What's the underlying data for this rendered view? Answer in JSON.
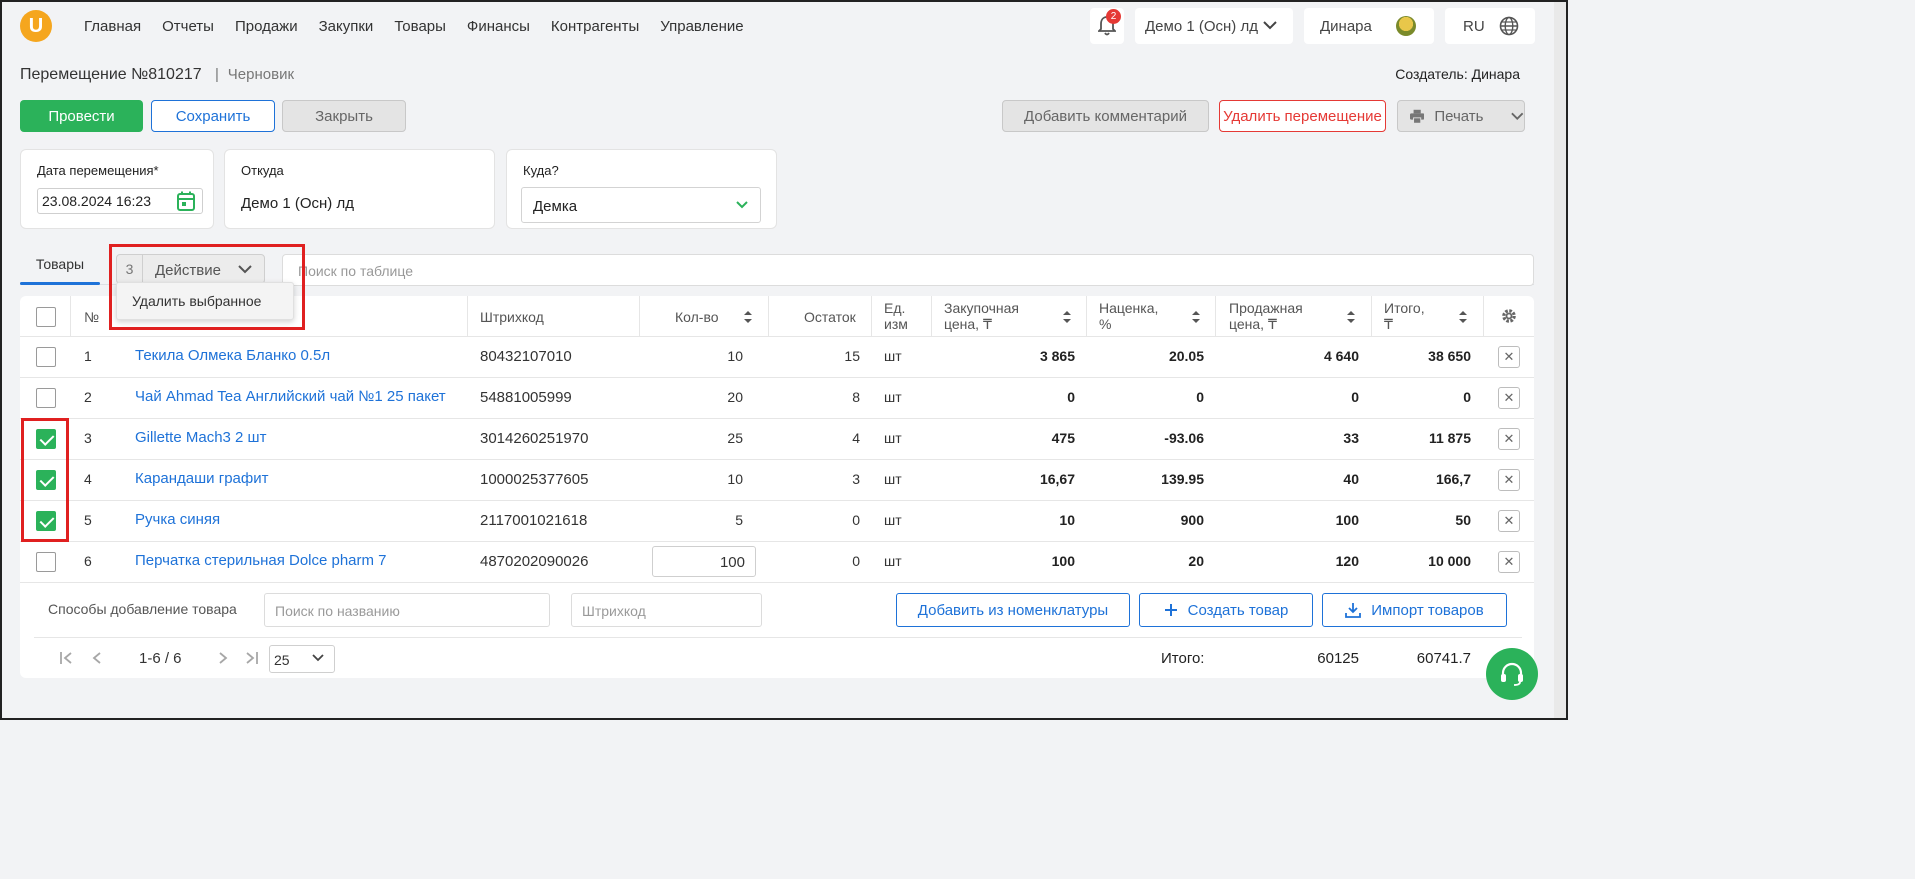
{
  "nav": {
    "logo": "U",
    "items": [
      "Главная",
      "Отчеты",
      "Продажи",
      "Закупки",
      "Товары",
      "Финансы",
      "Контрагенты",
      "Управление"
    ],
    "notifications": "2",
    "store": "Демо 1 (Осн) лд",
    "user": "Динара",
    "lang": "RU"
  },
  "header": {
    "title": "Перемещение №810217",
    "separator": "|",
    "status": "Черновик",
    "creator": "Создатель: Динара"
  },
  "toolbar": {
    "conduct": "Провести",
    "save": "Сохранить",
    "close": "Закрыть",
    "add_comment": "Добавить комментарий",
    "delete": "Удалить перемещение",
    "print": "Печать"
  },
  "fields": {
    "date_label": "Дата перемещения*",
    "date_value": "23.08.2024 16:23",
    "from_label": "Откуда",
    "from_value": "Демо 1 (Осн) лд",
    "to_label": "Куда?",
    "to_value": "Демка"
  },
  "tabs": {
    "goods": "Товары"
  },
  "actions": {
    "selected_count": "3",
    "label": "Действие",
    "dropdown_item": "Удалить выбранное",
    "search_placeholder": "Поиск по таблице"
  },
  "table": {
    "headers": {
      "num": "№",
      "barcode": "Штрихкод",
      "qty": "Кол-во",
      "stock": "Остаток",
      "unit_1": "Ед.",
      "unit_2": "изм",
      "purchase_1": "Закупочная",
      "purchase_2": "цена, ₸",
      "markup_1": "Наценка,",
      "markup_2": "%",
      "sale_1": "Продажная",
      "sale_2": "цена, ₸",
      "total_1": "Итого,",
      "total_2": "₸"
    },
    "rows": [
      {
        "n": "1",
        "name": "Текила Олмека Бланко 0.5л",
        "barcode": "80432107010",
        "qty": "10",
        "stock": "15",
        "unit": "шт",
        "purchase": "3 865",
        "markup": "20.05",
        "sale": "4 640",
        "total": "38 650",
        "checked": false
      },
      {
        "n": "2",
        "name": "Чай Ahmad Tea Английский чай №1 25 пакет",
        "barcode": "54881005999",
        "qty": "20",
        "stock": "8",
        "unit": "шт",
        "purchase": "0",
        "markup": "0",
        "sale": "0",
        "total": "0",
        "checked": false
      },
      {
        "n": "3",
        "name": "Gillette Mach3 2 шт",
        "barcode": "3014260251970",
        "qty": "25",
        "stock": "4",
        "unit": "шт",
        "purchase": "475",
        "markup": "-93.06",
        "sale": "33",
        "total": "11 875",
        "checked": true
      },
      {
        "n": "4",
        "name": "Карандаши графит",
        "barcode": "1000025377605",
        "qty": "10",
        "stock": "3",
        "unit": "шт",
        "purchase": "16,67",
        "markup": "139.95",
        "sale": "40",
        "total": "166,7",
        "checked": true
      },
      {
        "n": "5",
        "name": "Ручка синяя",
        "barcode": "2117001021618",
        "qty": "5",
        "stock": "0",
        "unit": "шт",
        "purchase": "10",
        "markup": "900",
        "sale": "100",
        "total": "50",
        "checked": true
      },
      {
        "n": "6",
        "name": "Перчатка стерильная Dolce pharm 7",
        "barcode": "4870202090026",
        "qty": "100",
        "stock": "0",
        "unit": "шт",
        "purchase": "100",
        "markup": "20",
        "sale": "120",
        "total": "10 000",
        "checked": false
      }
    ]
  },
  "add_row": {
    "label": "Способы добавление товара",
    "name_placeholder": "Поиск по названию",
    "barcode_placeholder": "Штрихкод",
    "from_catalog": "Добавить из номенклатуры",
    "create": "Создать товар",
    "import": "Импорт товаров"
  },
  "footer": {
    "range": "1-6 / 6",
    "page_size": "25",
    "total_label": "Итого:",
    "total_qty": "60125",
    "total_sum": "60741.7"
  },
  "colors": {
    "accent_green": "#2bb25a",
    "link_blue": "#1e72d8",
    "danger_red": "#e53935",
    "highlight_red": "#e02020"
  }
}
